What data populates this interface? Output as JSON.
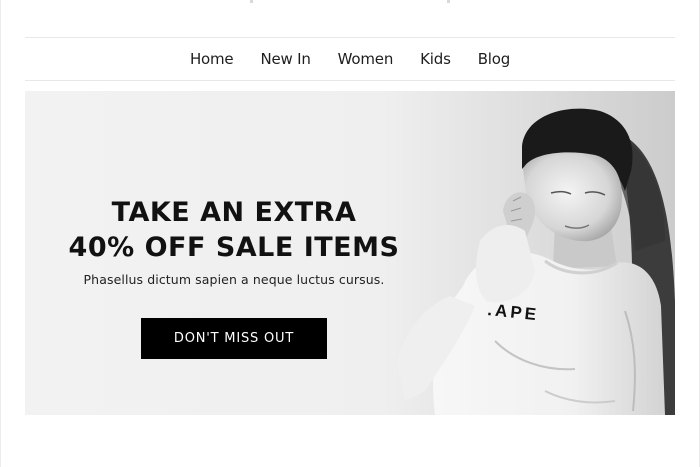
{
  "nav": {
    "items": [
      {
        "label": "Home"
      },
      {
        "label": "New In"
      },
      {
        "label": "Women"
      },
      {
        "label": "Kids"
      },
      {
        "label": "Blog"
      }
    ]
  },
  "hero": {
    "headline_line1": "TAKE AN EXTRA",
    "headline_line2": "40% OFF SALE ITEMS",
    "subtext": "Phasellus dictum sapien a neque luctus cursus.",
    "cta_label": "DON'T MISS OUT",
    "sweatshirt_print": ".APE",
    "image_style": "black-and-white"
  },
  "colors": {
    "cta_background": "#000000",
    "cta_text": "#ffffff",
    "headline": "#111111",
    "nav_text": "#1e1e1e",
    "divider": "#e8e8e8"
  }
}
